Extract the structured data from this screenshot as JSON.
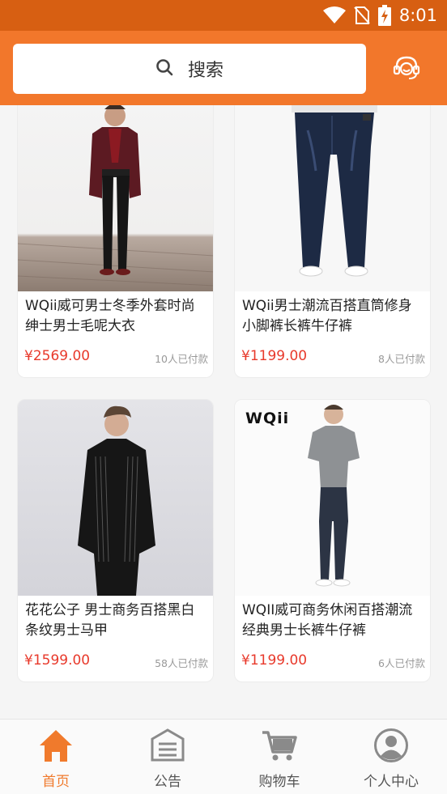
{
  "status_bar": {
    "time": "8:01",
    "icons": [
      "wifi-icon",
      "no-sim-icon",
      "battery-charging-icon"
    ]
  },
  "header": {
    "search_placeholder": "搜索",
    "search_icon": "search-icon",
    "service_icon": "headset-icon",
    "accent_color": "#f2772b"
  },
  "products": [
    {
      "title": "WQii威可男士冬季外套时尚绅士男士毛呢大衣",
      "price": "¥2569.00",
      "sales": "10人已付款"
    },
    {
      "title": "WQii男士潮流百搭直筒修身小脚裤长裤牛仔裤",
      "price": "¥1199.00",
      "sales": "8人已付款"
    },
    {
      "title": "花花公子 男士商务百搭黑白条纹男士马甲",
      "price": "¥1599.00",
      "sales": "58人已付款"
    },
    {
      "title": "WQII威可商务休闲百搭潮流经典男士长裤牛仔裤",
      "price": "¥1199.00",
      "sales": "6人已付款",
      "brand_logo": "WQii"
    }
  ],
  "bottom_nav": [
    {
      "label": "首页",
      "icon": "home-icon",
      "active": true
    },
    {
      "label": "公告",
      "icon": "announcement-icon",
      "active": false
    },
    {
      "label": "购物车",
      "icon": "cart-icon",
      "active": false
    },
    {
      "label": "个人中心",
      "icon": "user-icon",
      "active": false
    }
  ],
  "colors": {
    "status_bar": "#d75f12",
    "price": "#e8392b",
    "nav_active": "#f07a2c",
    "nav_inactive": "#8a8a8a"
  }
}
